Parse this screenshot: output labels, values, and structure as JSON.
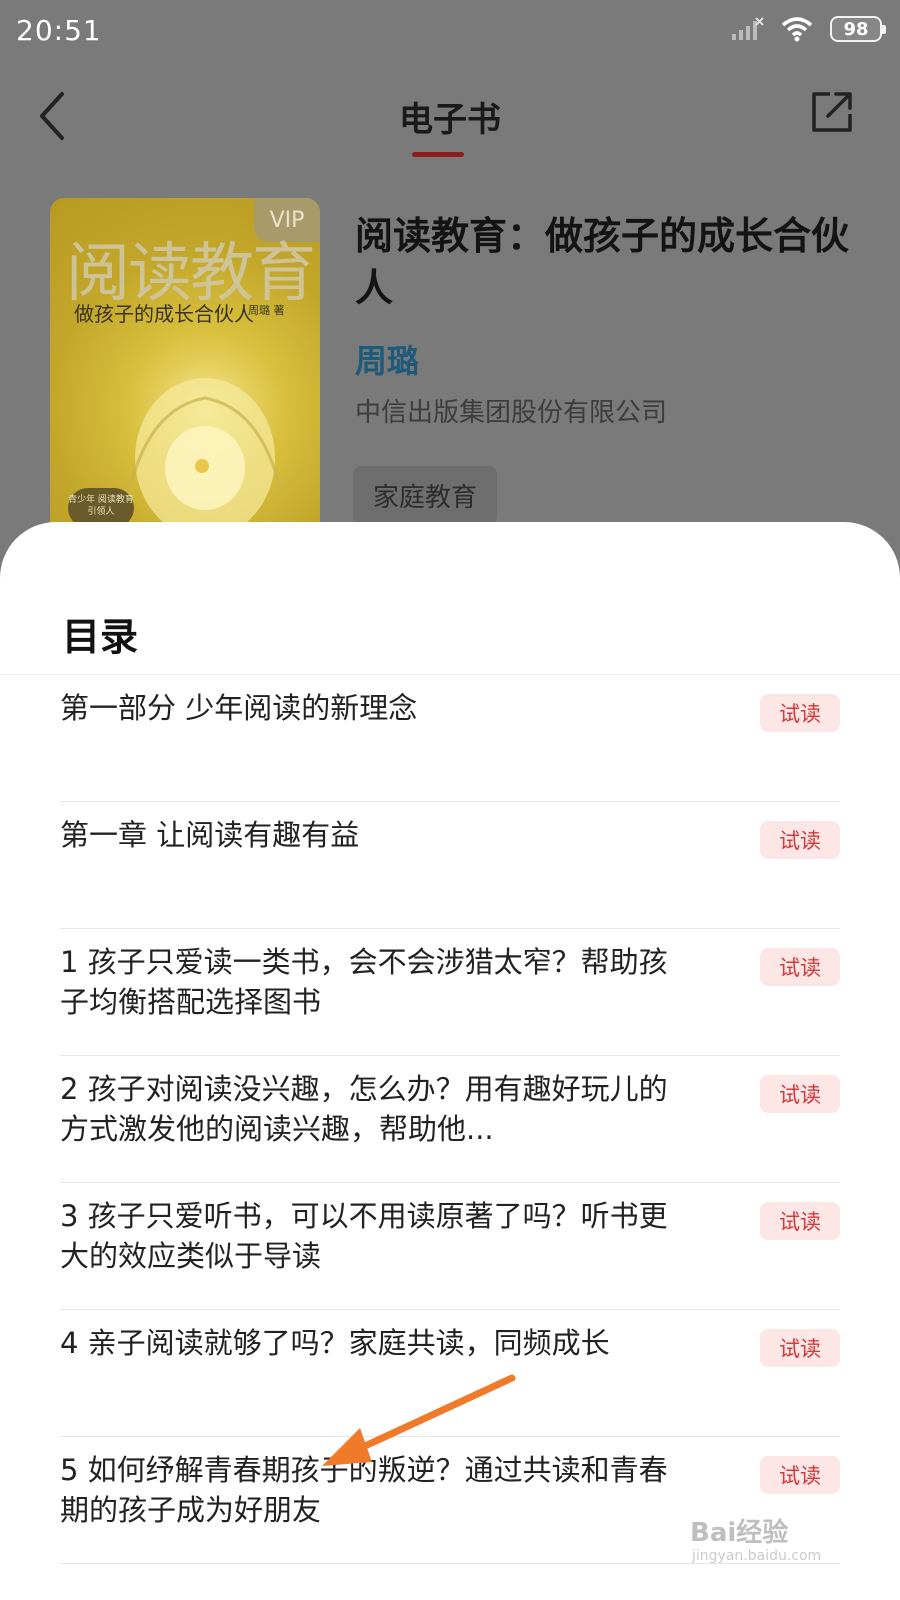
{
  "status_bar": {
    "time": "20:51",
    "battery": "98"
  },
  "header": {
    "title": "电子书"
  },
  "book": {
    "cover": {
      "vip": "VIP",
      "title": "阅读教育",
      "subtitle": "做孩子的成长合伙人",
      "author": "周璐 著",
      "badge": "青少年 阅读教育引领人"
    },
    "title": "阅读教育：做孩子的成长合伙人",
    "author": "周璐",
    "publisher": "中信出版集团股份有限公司",
    "tag": "家庭教育"
  },
  "toc": {
    "heading": "目录",
    "trial_label": "试读",
    "items": [
      {
        "text": "第一部分 少年阅读的新理念"
      },
      {
        "text": "第一章 让阅读有趣有益"
      },
      {
        "text": "1 孩子只爱读一类书，会不会涉猎太窄？帮助孩子均衡搭配选择图书"
      },
      {
        "text": "2 孩子对阅读没兴趣，怎么办？用有趣好玩儿的方式激发他的阅读兴趣，帮助他..."
      },
      {
        "text": "3 孩子只爱听书，可以不用读原著了吗？听书更大的效应类似于导读"
      },
      {
        "text": "4 亲子阅读就够了吗？家庭共读，同频成长"
      },
      {
        "text": "5 如何纾解青春期孩子的叛逆？通过共读和青春期的孩子成为好朋友"
      }
    ]
  },
  "watermark": {
    "text": "Bai经验",
    "url": "jingyan.baidu.com"
  },
  "colors": {
    "accent": "#d23a3a",
    "author": "#1e5a7a",
    "overlay": "#7a7a7a",
    "annotation_arrow": "#f07a2a"
  }
}
